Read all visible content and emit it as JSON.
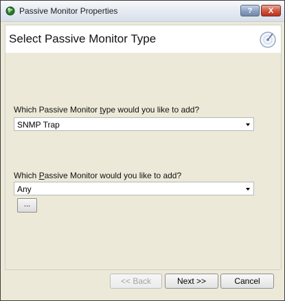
{
  "window": {
    "title": "Passive Monitor Properties",
    "help_label": "?",
    "close_label": "X"
  },
  "header": {
    "title": "Select Passive Monitor Type"
  },
  "form": {
    "type_label_pre": "Which Passive Monitor ",
    "type_label_access": "t",
    "type_label_post": "ype would you like to add?",
    "type_value": "SNMP Trap",
    "monitor_label_pre": "Which ",
    "monitor_label_access": "P",
    "monitor_label_post": "assive Monitor would you like to add?",
    "monitor_value": "Any",
    "browse_label": "..."
  },
  "footer": {
    "back_label": "<< Back",
    "next_label": "Next >>",
    "cancel_label": "Cancel"
  }
}
